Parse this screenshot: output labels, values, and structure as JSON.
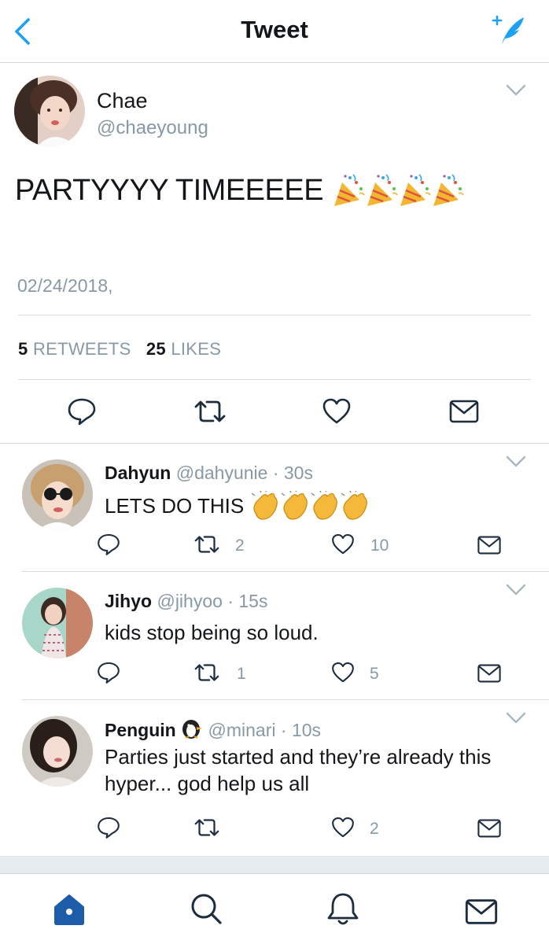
{
  "header": {
    "title": "Tweet",
    "back_icon": "chevron-left-icon",
    "compose_icon": "compose-tweet-icon",
    "accent": "#1da1f2"
  },
  "tweet": {
    "name": "Chae",
    "handle": "@chaeyoung",
    "text": "PARTYYYY TIMEEEEE",
    "emoji": "🎉🎉🎉🎉",
    "date": "02/24/2018,",
    "retweets_count": "5",
    "retweets_label": "RETWEETS",
    "likes_count": "25",
    "likes_label": "LIKES"
  },
  "replies": [
    {
      "name": "Dahyun",
      "handle": "@dahyunie",
      "time": "· 30s",
      "text": "LETS DO THIS",
      "emoji": "👏👏👏👏",
      "retweets": "2",
      "likes": "10"
    },
    {
      "name": "Jihyo",
      "handle": "@jihyoo",
      "time": "· 15s",
      "text": "kids stop being so loud.",
      "retweets": "1",
      "likes": "5"
    },
    {
      "name": "Penguin",
      "name_emoji": "🐧",
      "handle": "@minari",
      "time": "· 10s",
      "text": "Parties just started and they’re already this hyper... god help us all",
      "retweets": "",
      "likes": "2"
    }
  ],
  "tabbar": {
    "active_color": "#1d5ca8",
    "icons": [
      "home-icon",
      "search-icon",
      "notifications-icon",
      "messages-icon"
    ]
  },
  "colors": {
    "text_primary": "#14171a",
    "text_secondary": "#8899a6",
    "icon_grey": "#657786",
    "divider": "#d6dbe0"
  }
}
